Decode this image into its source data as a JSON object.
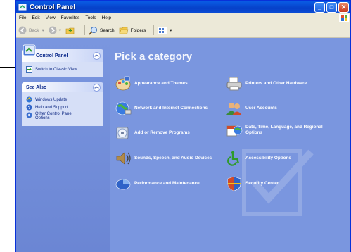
{
  "window": {
    "title": "Control Panel"
  },
  "menu": [
    "File",
    "Edit",
    "View",
    "Favorites",
    "Tools",
    "Help"
  ],
  "toolbar": {
    "back": "Back",
    "search": "Search",
    "folders": "Folders"
  },
  "leftpane": {
    "control_panel": {
      "title": "Control Panel",
      "switch_link": "Switch to Classic View"
    },
    "see_also": {
      "title": "See Also",
      "items": [
        "Windows Update",
        "Help and Support",
        "Other Control Panel Options"
      ]
    }
  },
  "main": {
    "heading": "Pick a category",
    "categories": [
      "Appearance and Themes",
      "Printers and Other Hardware",
      "Network and Internet Connections",
      "User Accounts",
      "Add or Remove Programs",
      "Date, Time, Language, and Regional Options",
      "Sounds, Speech, and Audio Devices",
      "Accessibility Options",
      "Performance and Maintenance",
      "Security Center"
    ]
  },
  "colors": {
    "titlebar": "#0a5ee6",
    "taskpane": "#7a96df",
    "panelbox": "#d6dff7"
  }
}
